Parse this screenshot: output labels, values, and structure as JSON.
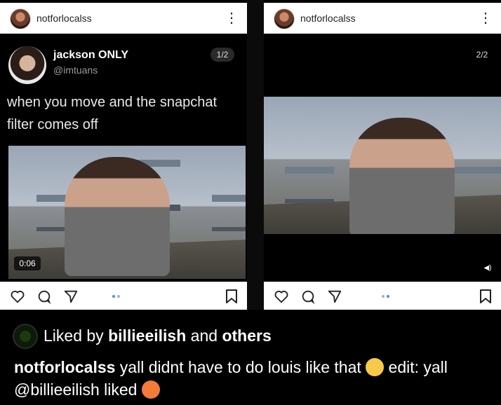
{
  "post1": {
    "username": "notforlocalss",
    "menu_icon": "more-vertical-icon",
    "tweet": {
      "display_name": "jackson ONLY",
      "handle": "@imtuans",
      "text": "when you move and the snapchat filter comes off"
    },
    "pager": "1/2",
    "video_time": "0:06"
  },
  "post2": {
    "username": "notforlocalss",
    "pager": "2/2",
    "volume_icon": "volume-icon"
  },
  "actions": {
    "icons": [
      "heart-icon",
      "comment-icon",
      "share-icon",
      "bookmark-icon"
    ]
  },
  "caption": {
    "liked_prefix": "Liked by ",
    "liked_user": "billieeilish",
    "liked_middle": " and ",
    "liked_others": "others",
    "author": "notforlocalss",
    "text_part1": " yall didnt have to do louis like that ",
    "text_part2": " edit: yall @billieeilish liked "
  },
  "colors": {
    "accent": "#3897f0",
    "background": "#000000",
    "bar": "#ffffff"
  }
}
